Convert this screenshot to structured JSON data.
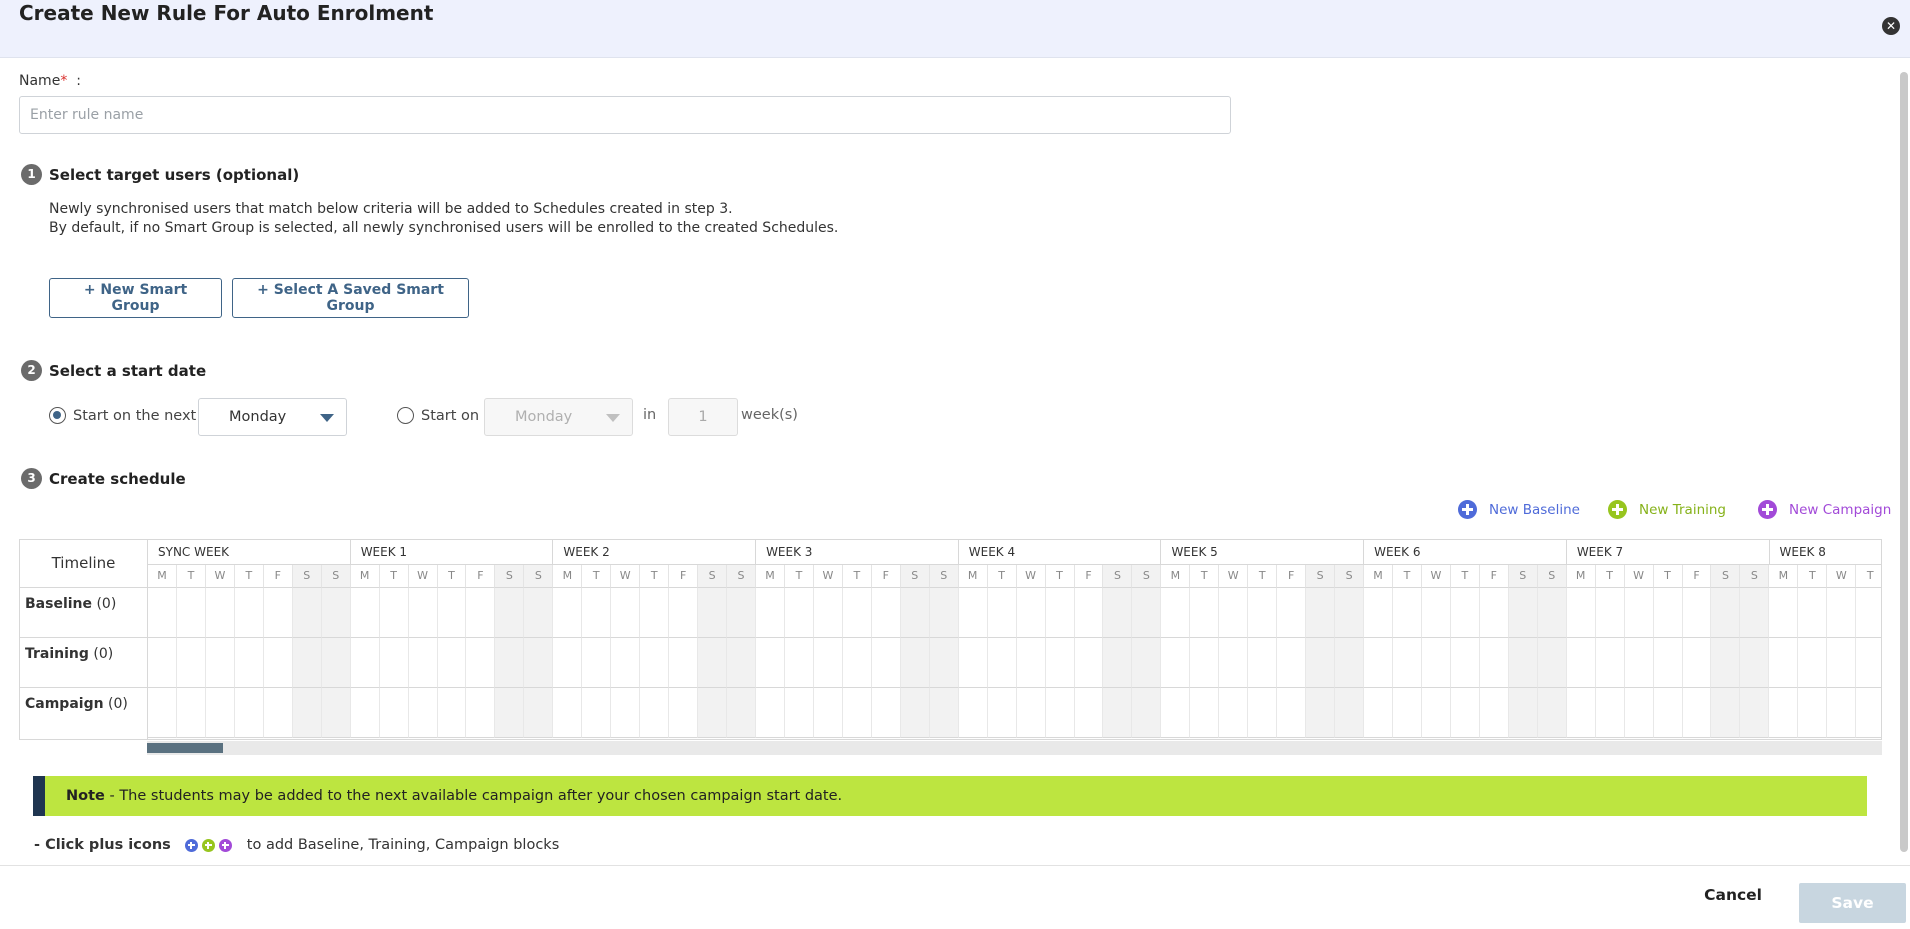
{
  "header": {
    "title": "Create New Rule For Auto Enrolment",
    "close_icon": "close-icon"
  },
  "name_field": {
    "label": "Name",
    "required_mark": "*",
    "colon": ":",
    "placeholder": "Enter rule name",
    "value": ""
  },
  "step1": {
    "number": "1",
    "title": "Select target users (optional)",
    "desc_line1": "Newly synchronised users that match below criteria will be added to Schedules created in step 3.",
    "desc_line2": "By default, if no Smart Group is selected, all newly synchronised users will be enrolled to the created Schedules.",
    "new_smart_group": "+ New Smart Group",
    "select_saved_group": "+ Select A Saved Smart Group"
  },
  "step2": {
    "number": "2",
    "title": "Select a start date",
    "option1_label": "Start on the next",
    "option1_value": "Monday",
    "option1_checked": true,
    "option2_label": "Start on",
    "option2_value": "Monday",
    "in_label": "in",
    "weeks_value": "1",
    "weeks_label": "week(s)"
  },
  "step3": {
    "number": "3",
    "title": "Create schedule",
    "legend": [
      {
        "label": "New Baseline",
        "color": "#4f6bd9",
        "icon": "plus-circle-icon"
      },
      {
        "label": "New Training",
        "color": "#97c51f",
        "icon": "plus-circle-icon"
      },
      {
        "label": "New Campaign",
        "color": "#a24ad8",
        "icon": "plus-circle-icon"
      }
    ]
  },
  "timeline": {
    "header_label": "Timeline",
    "rows": [
      {
        "name": "Baseline",
        "count": "(0)"
      },
      {
        "name": "Training",
        "count": "(0)"
      },
      {
        "name": "Campaign",
        "count": "(0)"
      }
    ],
    "weeks": [
      "SYNC WEEK",
      "WEEK 1",
      "WEEK 2",
      "WEEK 3",
      "WEEK 4",
      "WEEK 5",
      "WEEK 6",
      "WEEK 7",
      "WEEK 8"
    ],
    "days": [
      "M",
      "T",
      "W",
      "T",
      "F",
      "S",
      "S"
    ]
  },
  "note": {
    "bold": "Note",
    "text": " - The students may be added to the next available campaign after your chosen campaign start date."
  },
  "plus_hint": {
    "bold": "- Click plus icons",
    "text": "to add Baseline, Training, Campaign blocks"
  },
  "footer": {
    "cancel_label": "Cancel",
    "save_label": "Save"
  }
}
